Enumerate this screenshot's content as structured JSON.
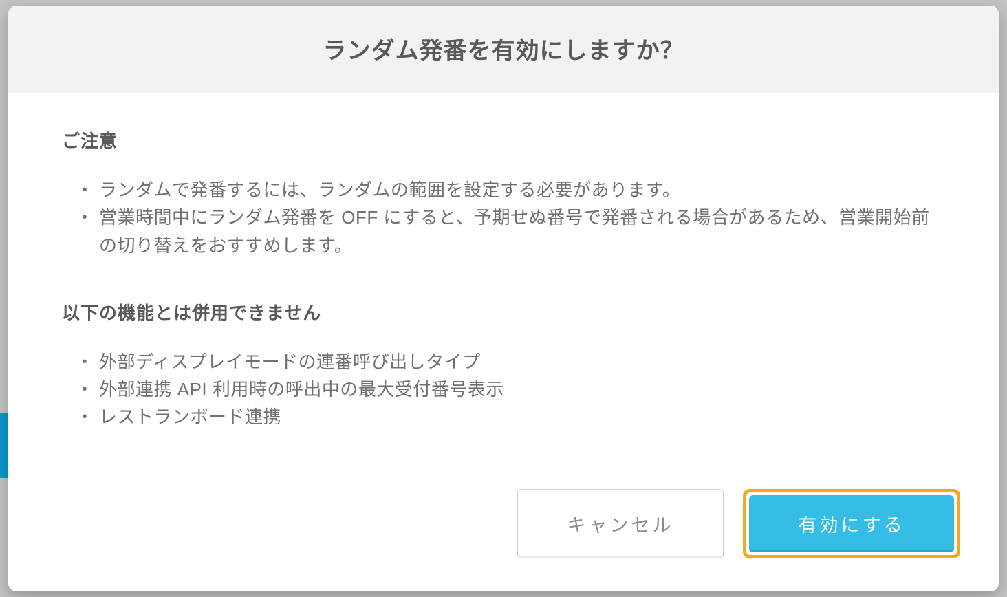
{
  "modal": {
    "title": "ランダム発番を有効にしますか？",
    "section1": {
      "heading": "ご注意",
      "items": [
        "ランダムで発番するには、ランダムの範囲を設定する必要があります。",
        "営業時間中にランダム発番を OFF にすると、予期せぬ番号で発番される場合があるため、営業開始前の切り替えをおすすめします。"
      ]
    },
    "section2": {
      "heading": "以下の機能とは併用できません",
      "items": [
        "外部ディスプレイモードの連番呼び出しタイプ",
        "外部連携 API 利用時の呼出中の最大受付番号表示",
        "レストランボード連携"
      ]
    },
    "buttons": {
      "cancel": "キャンセル",
      "confirm": "有効にする"
    }
  }
}
